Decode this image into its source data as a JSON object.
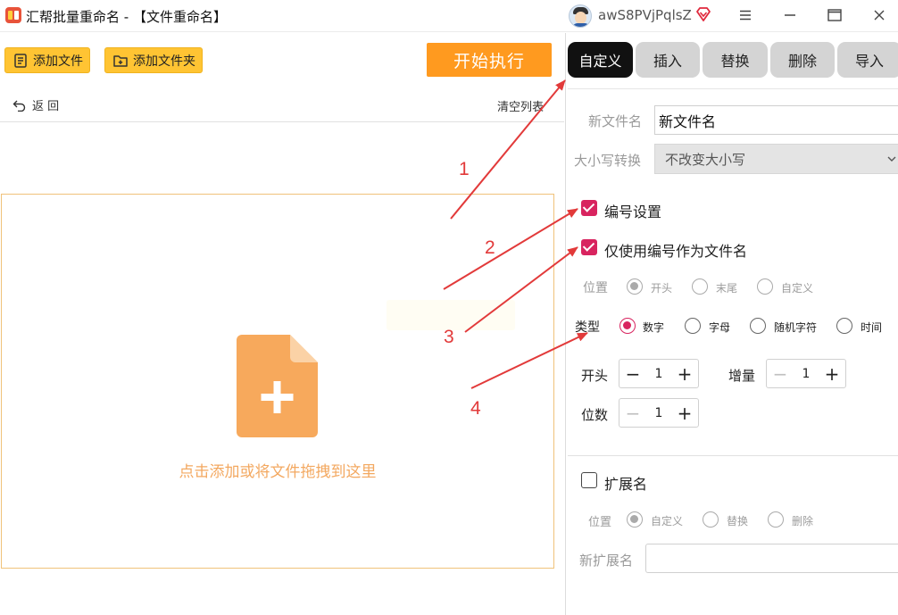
{
  "window": {
    "title": "汇帮批量重命名 - 【文件重命名】",
    "username": "awS8PVjPqlsZ",
    "logo_icon": "app-logo-icon",
    "vip_icon": "vip-diamond-icon",
    "menu_icon": "menu-icon",
    "minimize_icon": "minimize-icon",
    "maximize_icon": "maximize-icon",
    "close_icon": "close-icon"
  },
  "toolbar": {
    "add_file": "添加文件",
    "add_folder": "添加文件夹",
    "start": "开始执行",
    "back": "返 回",
    "clear_list": "清空列表"
  },
  "dropzone": {
    "hint": "点击添加或将文件拖拽到这里",
    "icon": "add-file-icon"
  },
  "tabs": [
    {
      "label": "自定义",
      "active": true
    },
    {
      "label": "插入",
      "active": false
    },
    {
      "label": "替换",
      "active": false
    },
    {
      "label": "删除",
      "active": false
    },
    {
      "label": "导入",
      "active": false
    }
  ],
  "settings": {
    "new_filename_label": "新文件名",
    "new_filename_value": "新文件名",
    "case_label": "大小写转换",
    "case_value": "不改变大小写",
    "numbering_label": "编号设置",
    "numbering_checked": true,
    "only_number_label": "仅使用编号作为文件名",
    "only_number_checked": true,
    "position_label": "位置",
    "position_options": [
      "开头",
      "末尾",
      "自定义"
    ],
    "position_selected": "开头",
    "type_label": "类型",
    "type_options": [
      "数字",
      "字母",
      "随机字符",
      "时间"
    ],
    "type_selected": "数字",
    "start_label": "开头",
    "start_value": "1",
    "increment_label": "增量",
    "increment_value": "1",
    "digits_label": "位数",
    "digits_value": "1",
    "minus_glyph": "−",
    "plus_glyph": "+",
    "ext_label": "扩展名",
    "ext_checked": false,
    "ext_position_label": "位置",
    "ext_position_options": [
      "自定义",
      "替换",
      "删除"
    ],
    "ext_position_selected": "自定义",
    "new_ext_label": "新扩展名",
    "new_ext_value": ""
  },
  "annotations": {
    "color": "#e23a3a",
    "labels": [
      "1",
      "2",
      "3",
      "4"
    ]
  },
  "colors": {
    "accent_yellow": "#ffc433",
    "start_orange": "#ff9a1f",
    "checkbox_pink": "#d8245f",
    "drop_hint": "#f3a860",
    "file_icon": "#f7a95c"
  }
}
